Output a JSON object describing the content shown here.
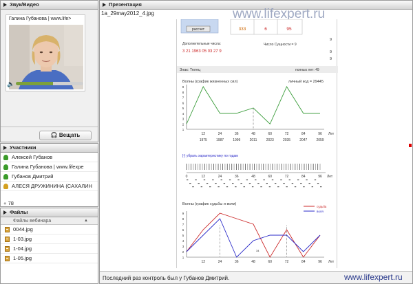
{
  "av": {
    "title": "Звук/Видео",
    "name": "Галина Губанова | www.life>",
    "broadcast": "Вещать",
    "volume": 55
  },
  "participants": {
    "title": "Участники",
    "items": [
      {
        "name": "Алексей Губанов",
        "color": "#3b9b2a"
      },
      {
        "name": "Галина Губанова | www.lifexpe",
        "color": "#3b9b2a"
      },
      {
        "name": "Губанов Дмитрий",
        "color": "#3b9b2a"
      },
      {
        "name": "АЛЕСЯ ДРУЖИНИНА (САХАЛИН",
        "color": "#d4a020"
      }
    ],
    "count": "78"
  },
  "files": {
    "title": "Файлы",
    "header": "Файлы вебинара",
    "items": [
      "0044.jpg",
      "1-03.jpg",
      "1-04.jpg",
      "1-05.jpg"
    ]
  },
  "pres": {
    "title": "Презентация",
    "filename": "1a_29may2012_4.jpg",
    "watermark": "www.lifexpert.ru",
    "footer": "Последний раз контроль был у Губанов Дмитрий.",
    "footer_site": "www.lifexpert.ru"
  },
  "doc": {
    "btn": "рассчет",
    "nums": [
      "333",
      "6",
      "95"
    ],
    "add_label": "Дополнительные числа:",
    "add_vals": "3  21  1963 05 03  27 9",
    "essence": "Число Сущности = 9",
    "nine": "9",
    "sign": "Знак: Телец",
    "years": "полных лет: 49",
    "c1_title": "Волны (график жизненных сил)",
    "c1_code": "личный код = 29445",
    "link": "[-] убрать характеристику по годам",
    "c2_title": "Волны (график судьбы и воли)",
    "leg_fate": "судьба",
    "leg_will": "воля",
    "ytick": [
      "1",
      "2",
      "3",
      "4",
      "5",
      "6",
      "7",
      "8",
      "9"
    ],
    "xtick": [
      "12",
      "24",
      "36",
      "48",
      "60",
      "72",
      "84",
      "96"
    ],
    "yrs": [
      "1975",
      "1987",
      "1999",
      "2011",
      "2023",
      "2035",
      "2047",
      "2059"
    ],
    "lnum": [
      "0",
      "12",
      "24",
      "36",
      "48",
      "60",
      "72",
      "84",
      "96"
    ],
    "leta": "Лет",
    "mark": "34"
  },
  "chart_data": [
    {
      "type": "line",
      "title": "Волны (график жизненных сил)",
      "x": [
        0,
        12,
        24,
        36,
        48,
        60,
        72,
        84,
        96
      ],
      "series": [
        {
          "values": [
            2,
            9,
            4,
            4,
            5,
            2,
            9,
            4,
            4
          ]
        }
      ],
      "ylim": [
        1,
        9
      ],
      "xlabel": "Лет"
    },
    {
      "type": "line",
      "title": "Волны (график судьбы и воли)",
      "x": [
        0,
        12,
        24,
        36,
        48,
        60,
        72,
        84,
        96
      ],
      "series": [
        {
          "name": "судьба",
          "values": [
            2,
            6,
            9,
            8,
            7,
            1,
            6,
            1,
            5
          ]
        },
        {
          "name": "воля",
          "values": [
            2,
            5,
            8,
            1,
            4,
            5,
            5,
            2,
            5
          ]
        }
      ],
      "ylim": [
        1,
        9
      ],
      "xlabel": "Лет"
    }
  ],
  "colors": {
    "green": "#3a9c3a",
    "red": "#cc2a2a",
    "blue": "#2a2ac8",
    "accent": "#7ca03a"
  }
}
